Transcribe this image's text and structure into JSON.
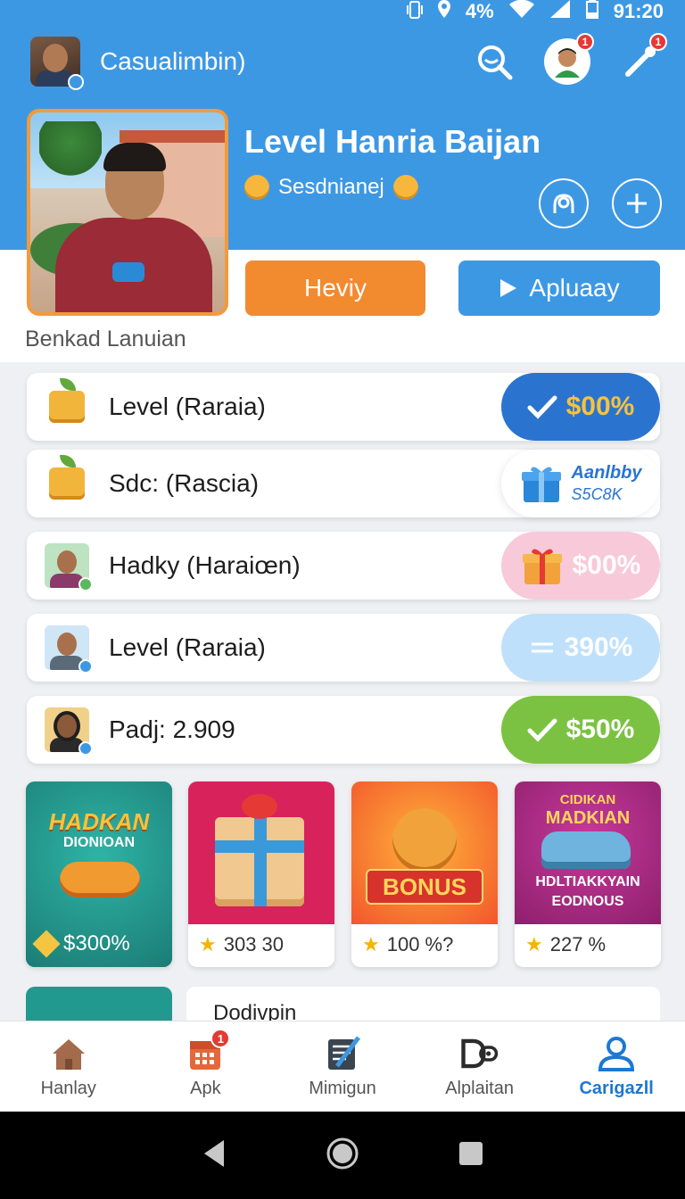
{
  "status_bar": {
    "battery": "4%",
    "time": "91:20"
  },
  "header": {
    "app_title": "Casualimbin)"
  },
  "top_actions": {
    "notif_badge": "1",
    "tools_badge": "1"
  },
  "profile": {
    "name": "Level Hanria Baijan",
    "subtitle": "Sesdnianej"
  },
  "buttons": {
    "primary": "Heviy",
    "secondary": "Apluaay"
  },
  "section_title": "Benkad Lanuian",
  "list": [
    {
      "label": "Level (Raraia)",
      "value": "$00%"
    },
    {
      "label": "Sdc: (Rascia)",
      "value_line1": "Aanlbby",
      "value_line2": "S5C8K"
    },
    {
      "label": "Hadky (Haraiœn)",
      "value": "$00%"
    },
    {
      "label": "Level (Raraia)",
      "value": "390%"
    },
    {
      "label": "Padj: 2.909",
      "value": "$50%"
    }
  ],
  "cards": [
    {
      "title": "HADKAN",
      "subtitle": "DIONIOAN",
      "value": "$300%"
    },
    {
      "value": "303 30"
    },
    {
      "badge": "BONUS",
      "value": "100 %?"
    },
    {
      "title_top": "CIDIKAN",
      "title": "MADKIAN",
      "line1": "HDLTIAKKYAIN",
      "line2": "EODNOUS",
      "value": "227 %"
    }
  ],
  "peek": {
    "title": "Dodivpin"
  },
  "bottom_nav": [
    {
      "label": "Hanlay"
    },
    {
      "label": "Apk",
      "badge": "1"
    },
    {
      "label": "Mimigun"
    },
    {
      "label": "Alplaitan"
    },
    {
      "label": "Carigazll"
    }
  ],
  "colors": {
    "primary_blue": "#3d98e4",
    "orange": "#f28a30",
    "green": "#7cc242",
    "active_nav": "#1e78d0"
  }
}
